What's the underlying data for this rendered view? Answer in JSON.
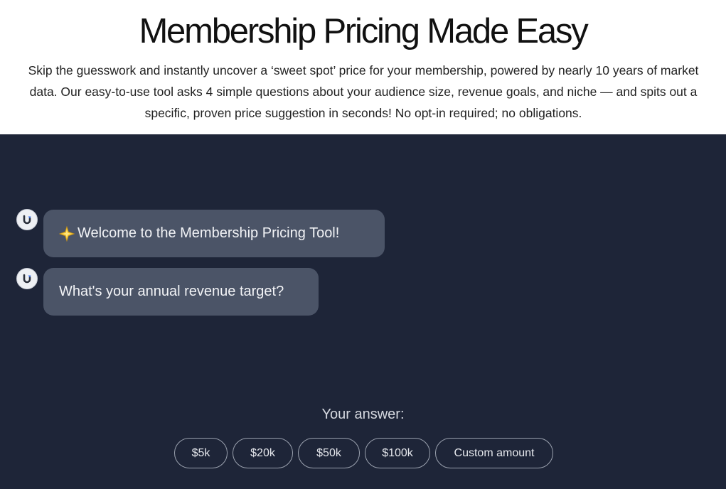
{
  "hero": {
    "title": "Membership Pricing Made Easy",
    "description": "Skip the guesswork and instantly uncover a ‘sweet spot’ price for your membership, powered by nearly 10 years of market data. Our easy-to-use tool asks 4 simple questions about your audience size, revenue goals, and niche — and spits out a specific, proven price suggestion in seconds! No opt-in required; no obligations."
  },
  "chat": {
    "messages": [
      {
        "icon": "sparkle-icon",
        "text": "Welcome to the Membership Pricing Tool!"
      },
      {
        "text": "What's your annual revenue target?"
      }
    ],
    "answer_label": "Your answer:",
    "options": [
      "$5k",
      "$20k",
      "$50k",
      "$100k",
      "Custom amount"
    ]
  },
  "colors": {
    "chat_background": "#1e2538",
    "bubble_background": "#4b5467",
    "avatar_accent": "#3b6fe8"
  }
}
